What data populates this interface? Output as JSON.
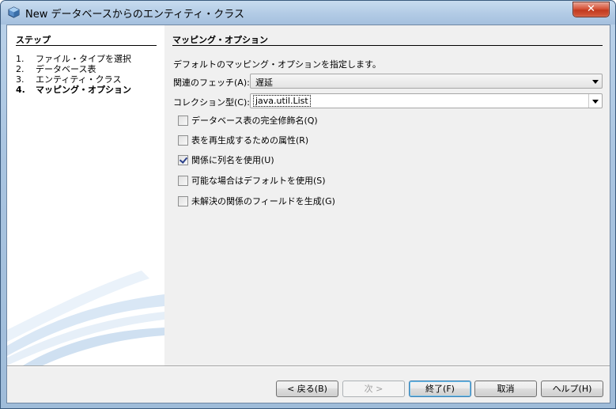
{
  "window": {
    "title": "New データベースからのエンティティ・クラス",
    "close_label": "✕"
  },
  "steps": {
    "title": "ステップ",
    "items": [
      {
        "num": "1.",
        "label": "ファイル・タイプを選択"
      },
      {
        "num": "2.",
        "label": "データベース表"
      },
      {
        "num": "3.",
        "label": "エンティティ・クラス"
      },
      {
        "num": "4.",
        "label": "マッピング・オプション"
      }
    ]
  },
  "main": {
    "title": "マッピング・オプション",
    "description": "デフォルトのマッピング・オプションを指定します。",
    "fetch": {
      "label": "関連のフェッチ(A):",
      "value": "遅延"
    },
    "collection": {
      "label": "コレクション型(C):",
      "value": "java.util.List"
    },
    "checkboxes": [
      {
        "label": "データベース表の完全修飾名(Q)",
        "checked": false
      },
      {
        "label": "表を再生成するための属性(R)",
        "checked": false
      },
      {
        "label": "関係に列名を使用(U)",
        "checked": true
      },
      {
        "label": "可能な場合はデフォルトを使用(S)",
        "checked": false
      },
      {
        "label": "未解決の関係のフィールドを生成(G)",
        "checked": false
      }
    ]
  },
  "buttons": {
    "back": "< 戻る(B)",
    "next": "次 >",
    "finish": "終了(F)",
    "cancel": "取消",
    "help": "ヘルプ(H)"
  }
}
